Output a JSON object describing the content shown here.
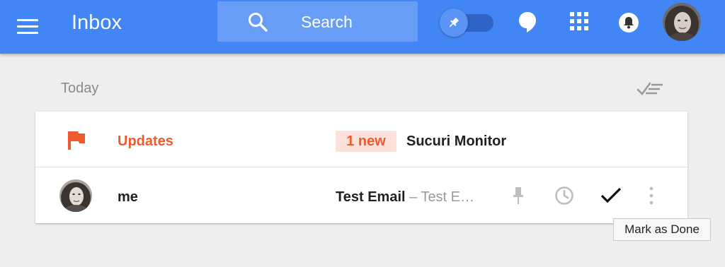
{
  "header": {
    "app_title": "Inbox",
    "search_placeholder": "Search",
    "pin_toggle": {
      "icon": "pin-icon",
      "state": "on"
    },
    "icons": [
      "menu-icon",
      "search-icon",
      "hangouts-icon",
      "apps-grid-icon",
      "notifications-bell-icon",
      "account-avatar"
    ]
  },
  "list": {
    "section_title": "Today",
    "sweep_icon": "sweep-done-icon",
    "rows": [
      {
        "icon": "flag-icon",
        "name": "Updates",
        "badge": "1 new",
        "sender": "Sucuri Monitor"
      },
      {
        "icon": "avatar",
        "name": "me",
        "subject": "Test Email",
        "separator": " – ",
        "snippet": "Test E…",
        "actions": [
          "pin-icon",
          "snooze-clock-icon",
          "mark-done-check-icon",
          "more-vert-icon"
        ]
      }
    ]
  },
  "tooltip": {
    "text": "Mark as Done"
  },
  "colors": {
    "header_bg": "#4285f4",
    "search_bg": "#679df6",
    "page_bg": "#eeeeee",
    "updates_accent": "#ef5a2f",
    "badge_bg": "#fbe1da"
  }
}
